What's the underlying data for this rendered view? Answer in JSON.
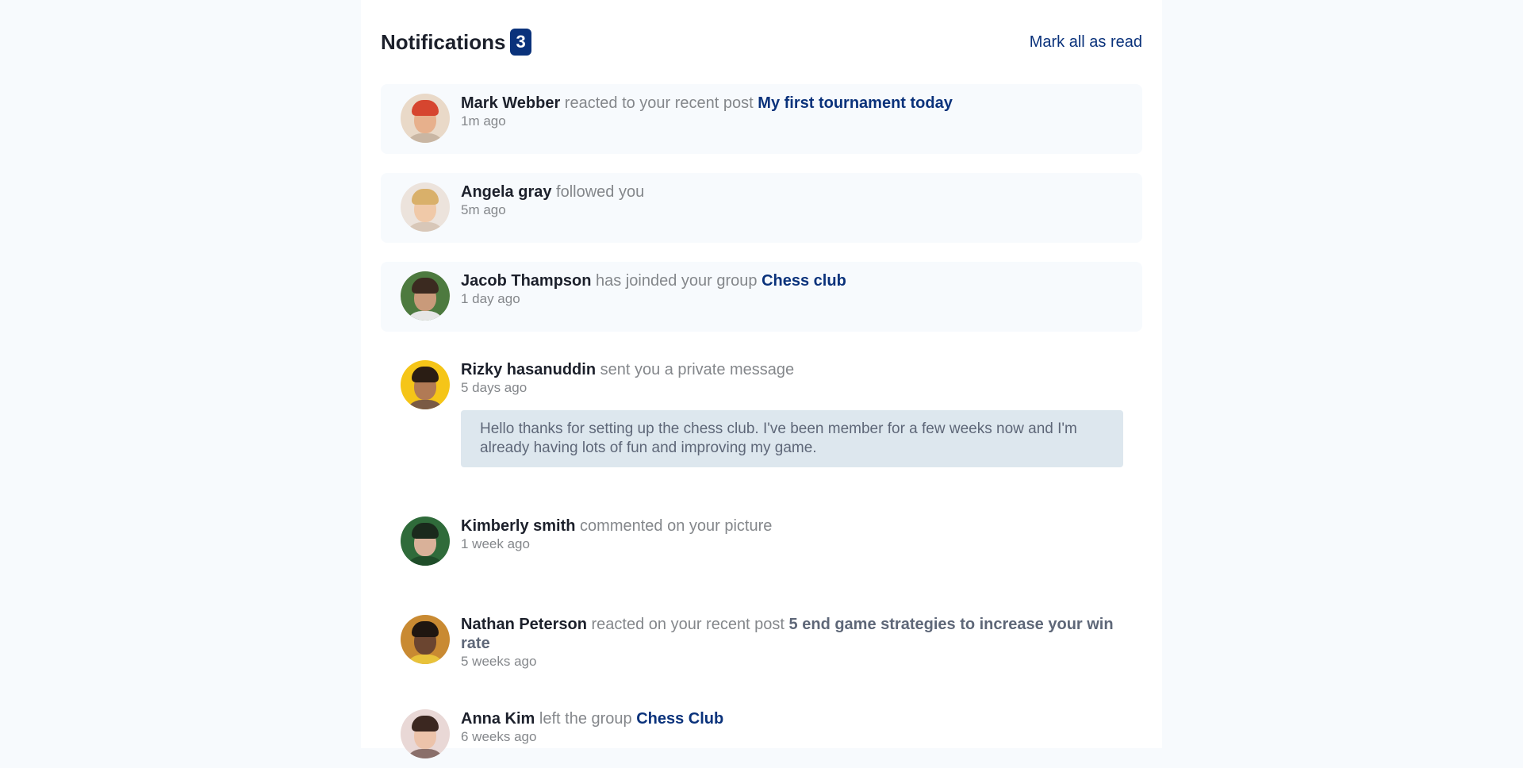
{
  "header": {
    "title": "Notifications",
    "count": "3",
    "mark_all": "Mark all as read"
  },
  "colors": {
    "accent": "#0a327b",
    "unread_bg": "#f7fafd",
    "message_bg": "#dde7ee"
  },
  "notifications": [
    {
      "name": "Mark Webber",
      "action": "reacted to your recent post",
      "target": "My first tournament today",
      "time": "1m ago",
      "unread": true
    },
    {
      "name": "Angela gray",
      "action": "followed you",
      "target": "",
      "time": "5m ago",
      "unread": true
    },
    {
      "name": "Jacob Thampson",
      "action": "has joinded your group",
      "target": "Chess club",
      "time": "1 day ago",
      "unread": true
    },
    {
      "name": "Rizky hasanuddin",
      "action": "sent you a private message",
      "target": "",
      "time": "5 days ago",
      "message": "Hello thanks for setting up the chess club. I've been member for a few weeks now and I'm already having lots of fun and improving my game.",
      "unread": false
    },
    {
      "name": "Kimberly smith",
      "action": "commented on your picture",
      "target": "",
      "time": "1 week ago",
      "unread": false
    },
    {
      "name": "Nathan Peterson",
      "action": "reacted on your recent post",
      "target": "5 end game strategies to increase your win rate",
      "time": "5 weeks ago",
      "unread": false
    },
    {
      "name": "Anna Kim",
      "action": "left the group",
      "target": "Chess Club",
      "time": "6 weeks ago",
      "unread": false
    }
  ]
}
